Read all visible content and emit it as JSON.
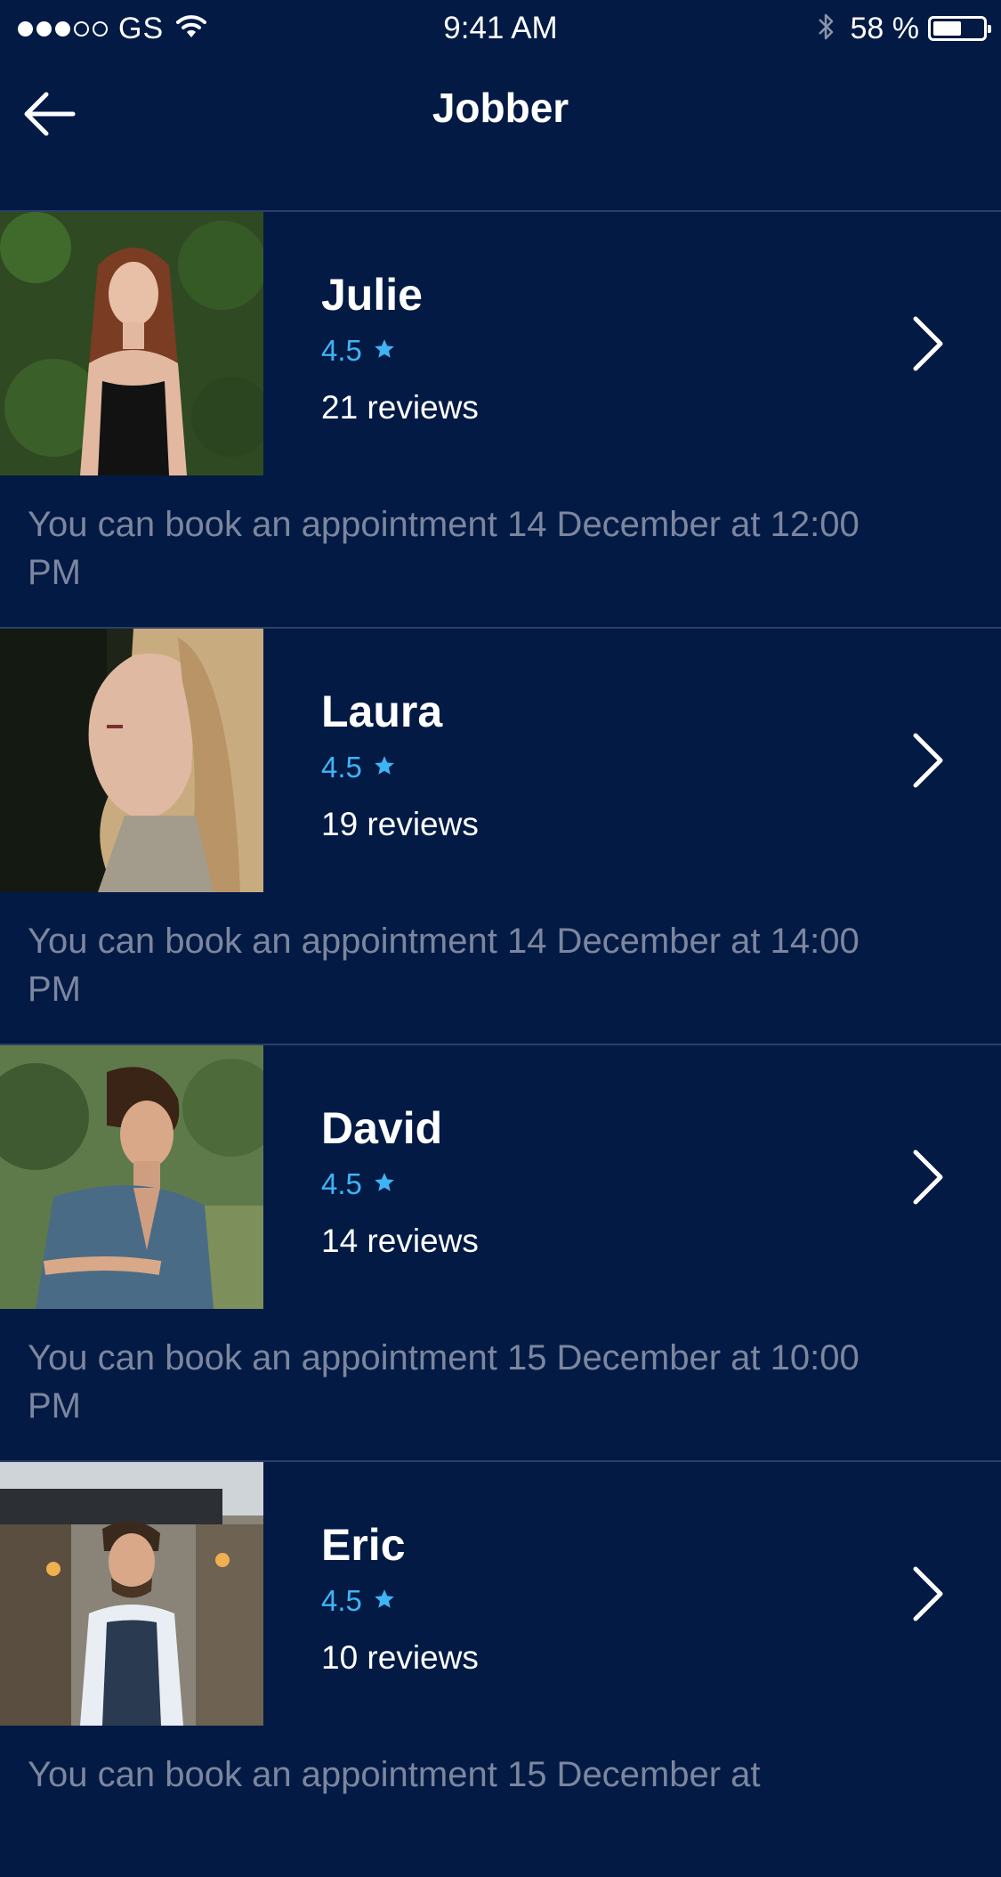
{
  "status_bar": {
    "carrier": "GS",
    "time": "9:41 AM",
    "battery": "58 %",
    "battery_level": 0.58,
    "signal_bars_filled": 3,
    "signal_bars_total": 5
  },
  "nav": {
    "title": "Jobber",
    "back_icon": "arrow-left-icon"
  },
  "colors": {
    "background": "#021a44",
    "accent": "#3fb4f4",
    "muted_text": "#7c869e",
    "divider": "#2b4068"
  },
  "jobbers": [
    {
      "name": "Julie",
      "rating": "4.5",
      "reviews": "21 reviews",
      "availability": "You can book an appointment 14 December at 12:00 PM"
    },
    {
      "name": "Laura",
      "rating": "4.5",
      "reviews": "19 reviews",
      "availability": "You can book an appointment 14 December at 14:00 PM"
    },
    {
      "name": "David",
      "rating": "4.5",
      "reviews": "14 reviews",
      "availability": "You can book an appointment 15 December at 10:00 PM"
    },
    {
      "name": "Eric",
      "rating": "4.5",
      "reviews": "10 reviews",
      "availability": "You can book an appointment 15 December at"
    }
  ]
}
